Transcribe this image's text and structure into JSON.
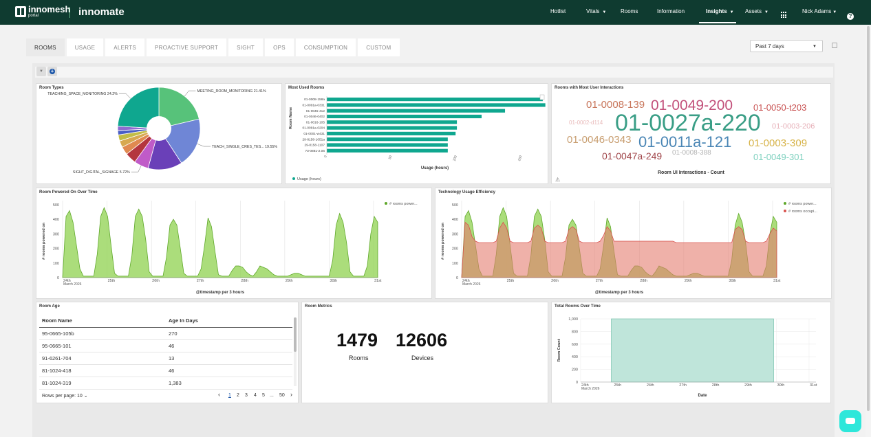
{
  "brand": {
    "logo_text": "innomesh",
    "logo_sub": "portal",
    "product": "innomate"
  },
  "nav": {
    "hotlist": "Hotlist",
    "vitals": "Vitals",
    "rooms": "Rooms",
    "information": "Information",
    "insights": "Insights",
    "assets": "Assets",
    "user": "Nick Adams"
  },
  "tabs": [
    "ROOMS",
    "USAGE",
    "ALERTS",
    "PROACTIVE SUPPORT",
    "SIGHT",
    "OPS",
    "CONSUMPTION",
    "CUSTOM"
  ],
  "range": {
    "value": "Past 7 days"
  },
  "panels": {
    "room_types": "Room Types",
    "most_used": "Most Used Rooms",
    "interactions": "Rooms with Most User Interactions",
    "powered_on": "Room Powered On Over Time",
    "efficiency": "Technology Usage Efficiency",
    "room_age": "Room Age",
    "room_metrics": "Room Metrics",
    "total_rooms": "Total Rooms Over Time"
  },
  "room_types_chart": {
    "type": "pie",
    "slices": [
      {
        "label": "MEETING_ROOM_MONITORING",
        "pct": 21.41,
        "color": "#57c27a",
        "show": "MEETING_ROOM_MONITORING  21.41%"
      },
      {
        "label": "TEACH_SINGLE_CRES_TES...",
        "pct": 19.55,
        "color": "#6f86d6",
        "show": "TEACH_SINGLE_CRES_TES...  19.55%"
      },
      {
        "label": "",
        "pct": 13.5,
        "color": "#6a40b8",
        "show": ""
      },
      {
        "label": "SIGHT_DIGITAL_SIGNAGE",
        "pct": 5.72,
        "color": "#c05bc8",
        "show": "SIGHT_DIGITAL_SIGNAGE  5.72%"
      },
      {
        "label": "",
        "pct": 4.4,
        "color": "#b4363e",
        "show": ""
      },
      {
        "label": "",
        "pct": 3.2,
        "color": "#e08a50",
        "show": ""
      },
      {
        "label": "",
        "pct": 2.6,
        "color": "#d7a950",
        "show": ""
      },
      {
        "label": "",
        "pct": 2.4,
        "color": "#c2bd45",
        "show": ""
      },
      {
        "label": "",
        "pct": 1.7,
        "color": "#4a5fc5",
        "show": ""
      },
      {
        "label": "",
        "pct": 1.72,
        "color": "#8f6bd0",
        "show": ""
      },
      {
        "label": "TEACHING_SPACE_MONITORING",
        "pct": 24.2,
        "color": "#0fa78f",
        "show": "TEACHING_SPACE_MONITORING  24.2%"
      }
    ]
  },
  "most_used_chart": {
    "type": "bar",
    "ylabel": "Room Name",
    "xlabel": "Usage (hours)",
    "legend": "Usage (hours)",
    "xticks": [
      "0",
      "50",
      "100",
      "150"
    ],
    "xlim": [
      0,
      165
    ],
    "categories": [
      "01-0008-158a",
      "01-0091a-0331",
      "01-0045-412",
      "01-0046-0402",
      "01-0016-105",
      "01-0091a-0204",
      "01-0001-w431",
      "29-8158-1051a",
      "29-8158-1107",
      "73-0881-2.06"
    ],
    "values": [
      166,
      168,
      137,
      119,
      100,
      100,
      99,
      93,
      93,
      93
    ]
  },
  "interactions_cloud": {
    "xlabel": "Room UI Interactions - Count",
    "words": [
      {
        "text": "01-0008-139",
        "color": "#c8755a",
        "size": 15
      },
      {
        "text": "01-0049-200",
        "color": "#c2507a",
        "size": 21
      },
      {
        "text": "01-0050-t203",
        "color": "#c85050",
        "size": 13
      },
      {
        "text": "01-0002-d114",
        "color": "#e8b9b9",
        "size": 8
      },
      {
        "text": "01-0027a-220",
        "color": "#3a9e86",
        "size": 34
      },
      {
        "text": "01-0003-206",
        "color": "#e6b0b8",
        "size": 11
      },
      {
        "text": "01-0046-0343",
        "color": "#c89e70",
        "size": 15
      },
      {
        "text": "01-0011a-121",
        "color": "#4a86b5",
        "size": 22
      },
      {
        "text": "01-0003-309",
        "color": "#d7b44a",
        "size": 15
      },
      {
        "text": "01-0047a-249",
        "color": "#a0464a",
        "size": 14
      },
      {
        "text": "01-0008-388",
        "color": "#b5b5b5",
        "size": 10
      },
      {
        "text": "01-0049-301",
        "color": "#7fd1bf",
        "size": 13
      }
    ]
  },
  "powered_on_chart": {
    "type": "area",
    "ylabel": "# rooms powered on",
    "xlabel": "@timestamp per 3 hours",
    "legend": "# rooms power...",
    "yticks": [
      "0",
      "100",
      "200",
      "300",
      "400",
      "500"
    ],
    "ylim": [
      0,
      500
    ],
    "xticks": [
      "24th",
      "25th",
      "26th",
      "27th",
      "28th",
      "29th",
      "30th",
      "31st"
    ],
    "xsub": "March 2026",
    "series": [
      {
        "values": [
          0,
          420,
          460,
          380,
          220,
          60,
          10,
          10,
          10,
          10,
          160,
          420,
          480,
          420,
          220,
          30,
          10,
          10,
          10,
          10,
          150,
          420,
          470,
          420,
          260,
          40,
          10,
          10,
          10,
          10,
          140,
          360,
          400,
          360,
          200,
          30,
          10,
          10,
          10,
          10,
          60,
          220,
          410,
          350,
          180,
          20,
          10,
          10,
          10,
          50,
          80,
          80,
          70,
          40,
          20,
          10,
          40,
          80,
          70,
          60,
          40,
          20,
          10,
          10,
          10,
          10,
          20,
          30,
          30,
          20,
          10,
          10,
          10,
          10,
          10,
          10,
          10,
          10,
          120,
          360,
          440,
          380,
          240,
          40,
          10,
          10,
          10,
          10,
          80,
          300,
          420,
          380
        ]
      }
    ]
  },
  "efficiency_chart": {
    "type": "area",
    "ylabel": "# rooms powered on",
    "xlabel": "@timestamp per 3 hours",
    "legend_a": "# rooms power...",
    "legend_b": "# rooms occupi...",
    "yticks": [
      "0",
      "100",
      "200",
      "300",
      "400",
      "500"
    ],
    "ylim": [
      0,
      500
    ],
    "xticks": [
      "24th",
      "25th",
      "26th",
      "27th",
      "28th",
      "29th",
      "30th",
      "31st"
    ],
    "xsub": "March 2026",
    "series": [
      {
        "name": "# rooms power...",
        "values": [
          0,
          420,
          460,
          380,
          220,
          60,
          10,
          10,
          10,
          10,
          160,
          420,
          480,
          420,
          220,
          30,
          10,
          10,
          10,
          10,
          150,
          420,
          470,
          420,
          260,
          40,
          10,
          10,
          10,
          10,
          140,
          360,
          400,
          360,
          200,
          30,
          10,
          10,
          10,
          10,
          60,
          220,
          410,
          350,
          180,
          20,
          10,
          10,
          10,
          50,
          80,
          80,
          70,
          40,
          20,
          10,
          40,
          80,
          70,
          60,
          40,
          20,
          10,
          10,
          10,
          10,
          20,
          30,
          30,
          20,
          10,
          10,
          10,
          10,
          10,
          10,
          10,
          10,
          120,
          360,
          440,
          380,
          240,
          40,
          10,
          10,
          10,
          10,
          80,
          300,
          420,
          380
        ]
      },
      {
        "name": "# rooms occupi...",
        "values": [
          0,
          380,
          360,
          280,
          250,
          240,
          240,
          240,
          240,
          240,
          250,
          340,
          380,
          340,
          250,
          240,
          240,
          240,
          240,
          240,
          250,
          340,
          360,
          340,
          250,
          240,
          240,
          240,
          240,
          240,
          250,
          330,
          350,
          330,
          250,
          240,
          240,
          240,
          240,
          240,
          250,
          290,
          350,
          320,
          250,
          250,
          250,
          250,
          250,
          250,
          250,
          250,
          250,
          250,
          250,
          250,
          250,
          250,
          250,
          250,
          250,
          250,
          240,
          240,
          240,
          240,
          240,
          240,
          240,
          240,
          240,
          240,
          240,
          240,
          240,
          240,
          240,
          240,
          240,
          330,
          350,
          330,
          250,
          240,
          240,
          240,
          240,
          240,
          250,
          300,
          340,
          320
        ]
      }
    ]
  },
  "room_age_table": {
    "headers": [
      "Room Name",
      "Age In Days"
    ],
    "rows": [
      [
        "95-0665-105b",
        "270"
      ],
      [
        "95-0665-101",
        "46"
      ],
      [
        "91-6261-704",
        "13"
      ],
      [
        "81-1024-418",
        "46"
      ],
      [
        "81-1024-319",
        "1,383"
      ]
    ],
    "rows_per_page": "Rows per page: 10",
    "pages": [
      "1",
      "2",
      "3",
      "4",
      "5",
      "...",
      "50"
    ],
    "prev": "‹",
    "next": "›"
  },
  "metrics": {
    "rooms": "1479",
    "rooms_label": "Rooms",
    "devices": "12606",
    "devices_label": "Devices"
  },
  "total_rooms_chart": {
    "type": "area",
    "ylabel": "Room Count",
    "xlabel": "Date",
    "yticks": [
      "0",
      "200",
      "400",
      "600",
      "800",
      "1,000"
    ],
    "ylim": [
      0,
      1000
    ],
    "xticks": [
      "24th",
      "25th",
      "24th",
      "27th",
      "28th",
      "29th",
      "30th",
      "31st"
    ],
    "xsub": "March 2026",
    "series": [
      {
        "values": [
          1000,
          1000,
          1000,
          1000,
          1000,
          1000
        ]
      }
    ]
  },
  "colors": {
    "topbar": "#0f3b30",
    "green": "#8fd14f",
    "red": "#e57d6f",
    "teal": "#bfe5da"
  }
}
